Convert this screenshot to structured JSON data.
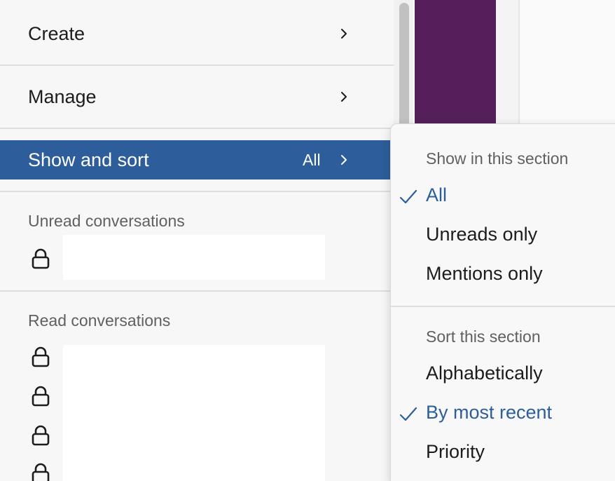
{
  "menu": {
    "create_label": "Create",
    "manage_label": "Manage",
    "show_sort_label": "Show and sort",
    "show_sort_value": "All"
  },
  "sections": {
    "unread_label": "Unread conversations",
    "read_label": "Read conversations"
  },
  "submenu": {
    "show_heading": "Show in this section",
    "show_options": [
      "All",
      "Unreads only",
      "Mentions only"
    ],
    "show_selected": "All",
    "sort_heading": "Sort this section",
    "sort_options": [
      "Alphabetically",
      "By most recent",
      "Priority"
    ],
    "sort_selected": "By most recent"
  },
  "colors": {
    "highlight": "#2d5e9b",
    "sidebar_purple": "#541f5a"
  },
  "icons": {
    "row_icon": "lock-icon",
    "chevron": "chevron-right-icon",
    "check": "checkmark-icon"
  }
}
